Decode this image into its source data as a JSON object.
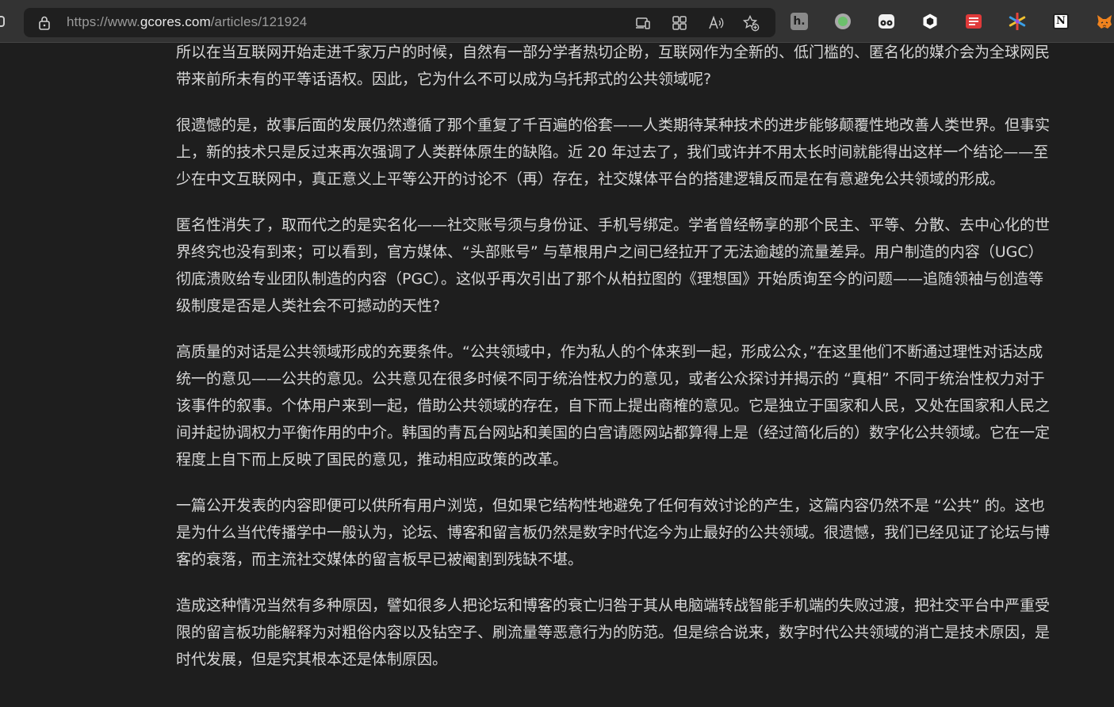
{
  "browser": {
    "url_prefix": "https://www.",
    "url_host": "gcores.com",
    "url_path": "/articles/121924",
    "toolbar_icons": [
      "device-icon",
      "apps-icon",
      "read-aloud-icon",
      "favorite-add-icon"
    ],
    "extensions": [
      "h-extension-icon",
      "green-circle-extension-icon",
      "eyes-extension-icon",
      "hexagon-extension-icon",
      "red-list-extension-icon",
      "color-star-extension-icon",
      "notion-extension-icon",
      "metamask-fox-icon"
    ],
    "extension_labels": {
      "h": "h.",
      "notion": "N"
    }
  },
  "article": {
    "paragraphs": [
      "所以在当互联网开始走进千家万户的时候，自然有一部分学者热切企盼，互联网作为全新的、低门槛的、匿名化的媒介会为全球网民带来前所未有的平等话语权。因此，它为什么不可以成为乌托邦式的公共领域呢?",
      "很遗憾的是，故事后面的发展仍然遵循了那个重复了千百遍的俗套——人类期待某种技术的进步能够颠覆性地改善人类世界。但事实上，新的技术只是反过来再次强调了人类群体原生的缺陷。近 20 年过去了，我们或许并不用太长时间就能得出这样一个结论——至少在中文互联网中，真正意义上平等公开的讨论不（再）存在，社交媒体平台的搭建逻辑反而是在有意避免公共领域的形成。",
      "匿名性消失了，取而代之的是实名化——社交账号须与身份证、手机号绑定。学者曾经畅享的那个民主、平等、分散、去中心化的世界终究也没有到来；可以看到，官方媒体、“头部账号” 与草根用户之间已经拉开了无法逾越的流量差异。用户制造的内容（UGC）彻底溃败给专业团队制造的内容（PGC）。这似乎再次引出了那个从柏拉图的《理想国》开始质询至今的问题——追随领袖与创造等级制度是否是人类社会不可撼动的天性?",
      "高质量的对话是公共领域形成的充要条件。“公共领域中，作为私人的个体来到一起，形成公众，”在这里他们不断通过理性对话达成统一的意见——公共的意见。公共意见在很多时候不同于统治性权力的意见，或者公众探讨并揭示的 “真相” 不同于统治性权力对于该事件的叙事。个体用户来到一起，借助公共领域的存在，自下而上提出商榷的意见。它是独立于国家和人民，又处在国家和人民之间并起协调权力平衡作用的中介。韩国的青瓦台网站和美国的白宫请愿网站都算得上是（经过简化后的）数字化公共领域。它在一定程度上自下而上反映了国民的意见，推动相应政策的改革。",
      "一篇公开发表的内容即便可以供所有用户浏览，但如果它结构性地避免了任何有效讨论的产生，这篇内容仍然不是 “公共” 的。这也是为什么当代传播学中一般认为，论坛、博客和留言板仍然是数字时代迄今为止最好的公共领域。很遗憾，我们已经见证了论坛与博客的衰落，而主流社交媒体的留言板早已被阉割到残缺不堪。",
      "造成这种情况当然有多种原因，譬如很多人把论坛和博客的衰亡归咎于其从电脑端转战智能手机端的失败过渡，把社交平台中严重受限的留言板功能解释为对粗俗内容以及钻空子、刷流量等恶意行为的防范。但是综合说来，数字时代公共领域的消亡是技术原因，是时代发展，但是究其根本还是体制原因。"
    ]
  }
}
